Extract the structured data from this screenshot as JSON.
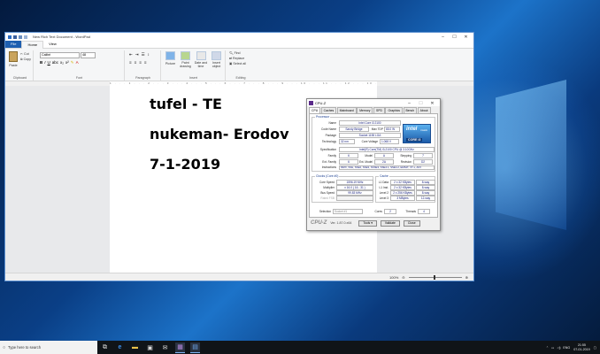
{
  "wordpad": {
    "title": "New Rich Text Document - WordPad",
    "tabs": {
      "file": "File",
      "home": "Home",
      "view": "View"
    },
    "clipboard": {
      "paste": "Paste",
      "cut": "Cut",
      "copy": "Copy",
      "label": "Clipboard"
    },
    "font": {
      "name": "Calibri",
      "size": "48",
      "label": "Font"
    },
    "paragraph": {
      "label": "Paragraph"
    },
    "insert": {
      "picture": "Picture",
      "paint_drawing": "Paint drawing",
      "date_time": "Date and time",
      "insert_object": "Insert object",
      "label": "Insert"
    },
    "editing": {
      "find": "Find",
      "replace": "Replace",
      "select_all": "Select all",
      "label": "Editing"
    },
    "ruler": "1 · · · 1 · · · 2 · · · 3 · · · 4 · · · 5 · · · 6 · · · 7 · · · 8 · · · 9 · · · 10 · · · 11 · · · 12 · · · 13 · · · 14 · · · 15 · · · 16 · · · 17 · · · 18",
    "document": {
      "line1": "tufel - TE",
      "line2": "nukeman- Erodov",
      "line3": "7-1-2019"
    },
    "zoom": "100%"
  },
  "cpuz": {
    "title": "CPU-Z",
    "tabs": [
      "CPU",
      "Caches",
      "Mainboard",
      "Memory",
      "SPD",
      "Graphics",
      "Bench",
      "About"
    ],
    "processor_label": "Processor",
    "name_label": "Name",
    "name": "Intel Core i3 2100",
    "codename_label": "Code Name",
    "codename": "Sandy Bridge",
    "maxtdp_label": "Max TDP",
    "maxtdp": "65.0 W",
    "package_label": "Package",
    "package": "Socket 1155 LGA",
    "technology_label": "Technology",
    "technology": "32 nm",
    "voltage_label": "Core Voltage",
    "voltage": "1.068 V",
    "spec_label": "Specification",
    "spec": "Intel(R) Core(TM) i3-2100 CPU @ 3.10GHz",
    "family_label": "Family",
    "family": "6",
    "model_label": "Model",
    "model": "A",
    "stepping_label": "Stepping",
    "stepping": "7",
    "extfamily_label": "Ext. Family",
    "extfamily": "6",
    "extmodel_label": "Ext. Model",
    "extmodel": "2A",
    "revision_label": "Revision",
    "revision": "D2",
    "instructions_label": "Instructions",
    "instructions": "MMX, SSE, SSE2, SSE3, SSSE3, SSE4.1, SSE4.2, EM64T, VT-x, AVX",
    "clocks_label": "Clocks (Core #0)",
    "corespeed_label": "Core Speed",
    "corespeed": "1596.19 MHz",
    "multiplier_label": "Multiplier",
    "multiplier": "x 16.0 ( 16 - 31 )",
    "busspeed_label": "Bus Speed",
    "busspeed": "99.83 MHz",
    "ratedfsb_label": "Rated FSB",
    "ratedfsb": "",
    "cache_label": "Cache",
    "l1d_label": "L1 Data",
    "l1d": "2 x 32 KBytes",
    "l1d_way": "8-way",
    "l1i_label": "L1 Inst.",
    "l1i": "2 x 32 KBytes",
    "l1i_way": "8-way",
    "l2_label": "Level 2",
    "l2": "2 x 256 KBytes",
    "l2_way": "8-way",
    "l3_label": "Level 3",
    "l3": "3 MBytes",
    "l3_way": "12-way",
    "selection_label": "Selection",
    "selection": "Socket #1",
    "cores_label": "Cores",
    "cores": "2",
    "threads_label": "Threads",
    "threads": "4",
    "brand": "CPU-Z",
    "version": "Ver. 1.87.0.x64",
    "tools": "Tools",
    "validate": "Validate",
    "close": "Close",
    "intel_word": "intel",
    "intel_inside": "inside",
    "intel_core": "CORE i3"
  },
  "taskbar": {
    "search_placeholder": "Type here to search",
    "time": "21:55",
    "date": "07-01-2019",
    "lang": "ENG"
  },
  "colors": {
    "accent": "#1e5fb0",
    "cpuz_purple": "#5b2a8a"
  }
}
